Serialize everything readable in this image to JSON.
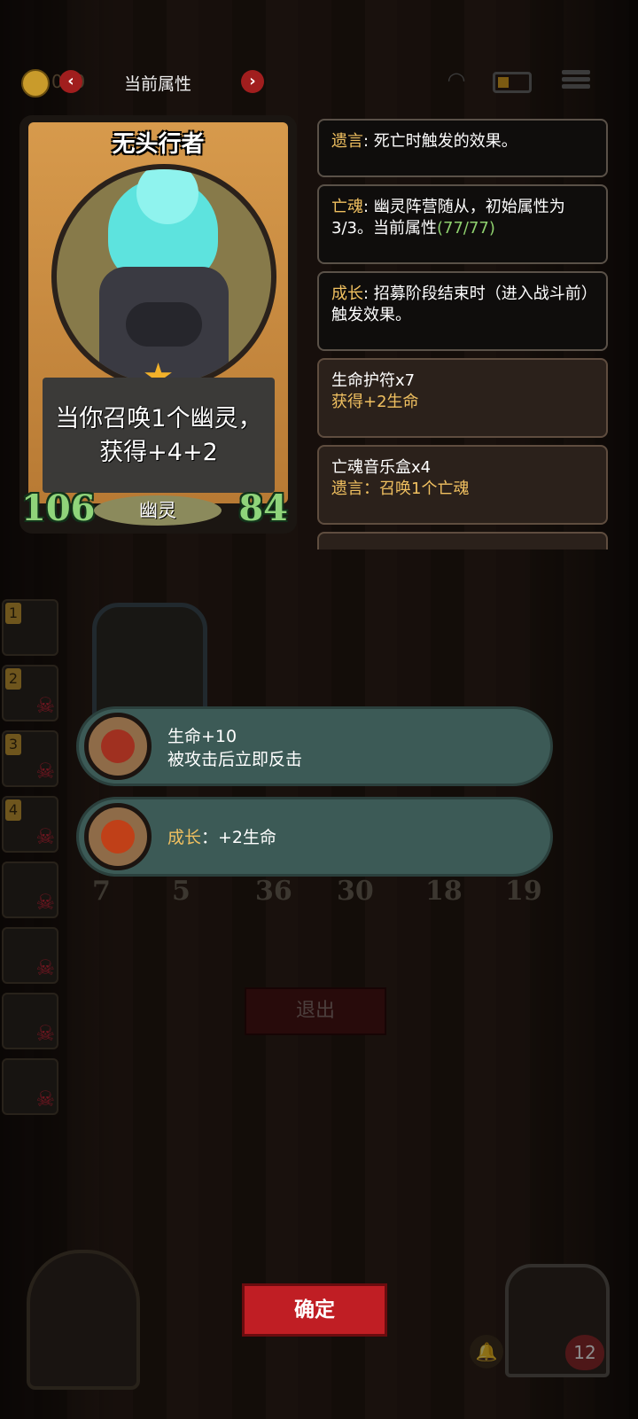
{
  "topbar": {
    "coin_value": "020",
    "title": "当前属性",
    "prev_icon": "chevron-left",
    "next_icon": "chevron-right"
  },
  "card": {
    "name": "无头行者",
    "ability_line1": "当你召唤1个幽灵，",
    "ability_line2": "获得+4+2",
    "attack": "106",
    "health": "84",
    "tribe": "幽灵"
  },
  "tooltips": [
    {
      "keyword": "遗言",
      "text": ": 死亡时触发的效果。"
    },
    {
      "keyword": "亡魂",
      "text": ": 幽灵阵营随从，初始属性为3/3。当前属性",
      "extra": "(77/77)"
    },
    {
      "keyword": "成长",
      "text": ": 招募阶段结束时（进入战斗前）触发效果。"
    },
    {
      "title": "生命护符x7",
      "desc": "获得+2生命"
    },
    {
      "title": "亡魂音乐盒x4",
      "desc": "遗言：召唤1个亡魂"
    }
  ],
  "sidebar": {
    "slots": [
      "1",
      "2",
      "3",
      "4",
      "",
      "",
      "",
      ""
    ]
  },
  "board": {
    "unit1": {
      "attack": "7",
      "health": "5"
    },
    "unit2": {
      "attack": "36",
      "health": "30"
    },
    "unit3": {
      "attack": "18",
      "health": "19"
    }
  },
  "upgrades": [
    {
      "line1": "生命+10",
      "line2": "被攻击后立即反击"
    },
    {
      "keyword": "成长",
      "text": "：+2生命"
    }
  ],
  "buttons": {
    "exit": "退出",
    "confirm": "确定"
  },
  "player": {
    "lives": "12"
  },
  "colors": {
    "keyword": "#f0c060",
    "green_stat": "#8ed06e",
    "confirm_red": "#c01e24",
    "upgrade_teal": "#3c5a56"
  }
}
